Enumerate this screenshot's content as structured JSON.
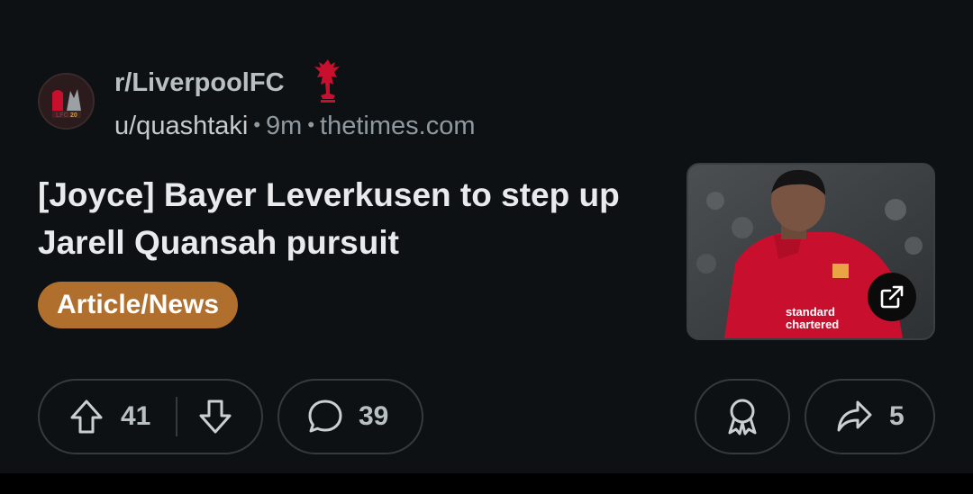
{
  "post": {
    "subreddit": "r/LiverpoolFC",
    "author": "u/quashtaki",
    "age": "9m",
    "domain": "thetimes.com",
    "title": "[Joyce] Bayer Leverkusen to step up Jarell Quansah pursuit",
    "flair": "Article/News",
    "flair_color": "#b06f2c",
    "thumbnail_icon": "external-link-icon"
  },
  "actions": {
    "upvotes": "41",
    "comments": "39",
    "shares": "5"
  },
  "icons": {
    "subreddit_avatar": "liverpool-crest-icon",
    "flair_emoji": "liverbird-icon",
    "upvote": "arrow-up-icon",
    "downvote": "arrow-down-icon",
    "comment": "comment-bubble-icon",
    "award": "award-icon",
    "share": "share-arrow-icon"
  },
  "theme": {
    "background": "#0e1113",
    "accent_red": "#c8102e"
  }
}
